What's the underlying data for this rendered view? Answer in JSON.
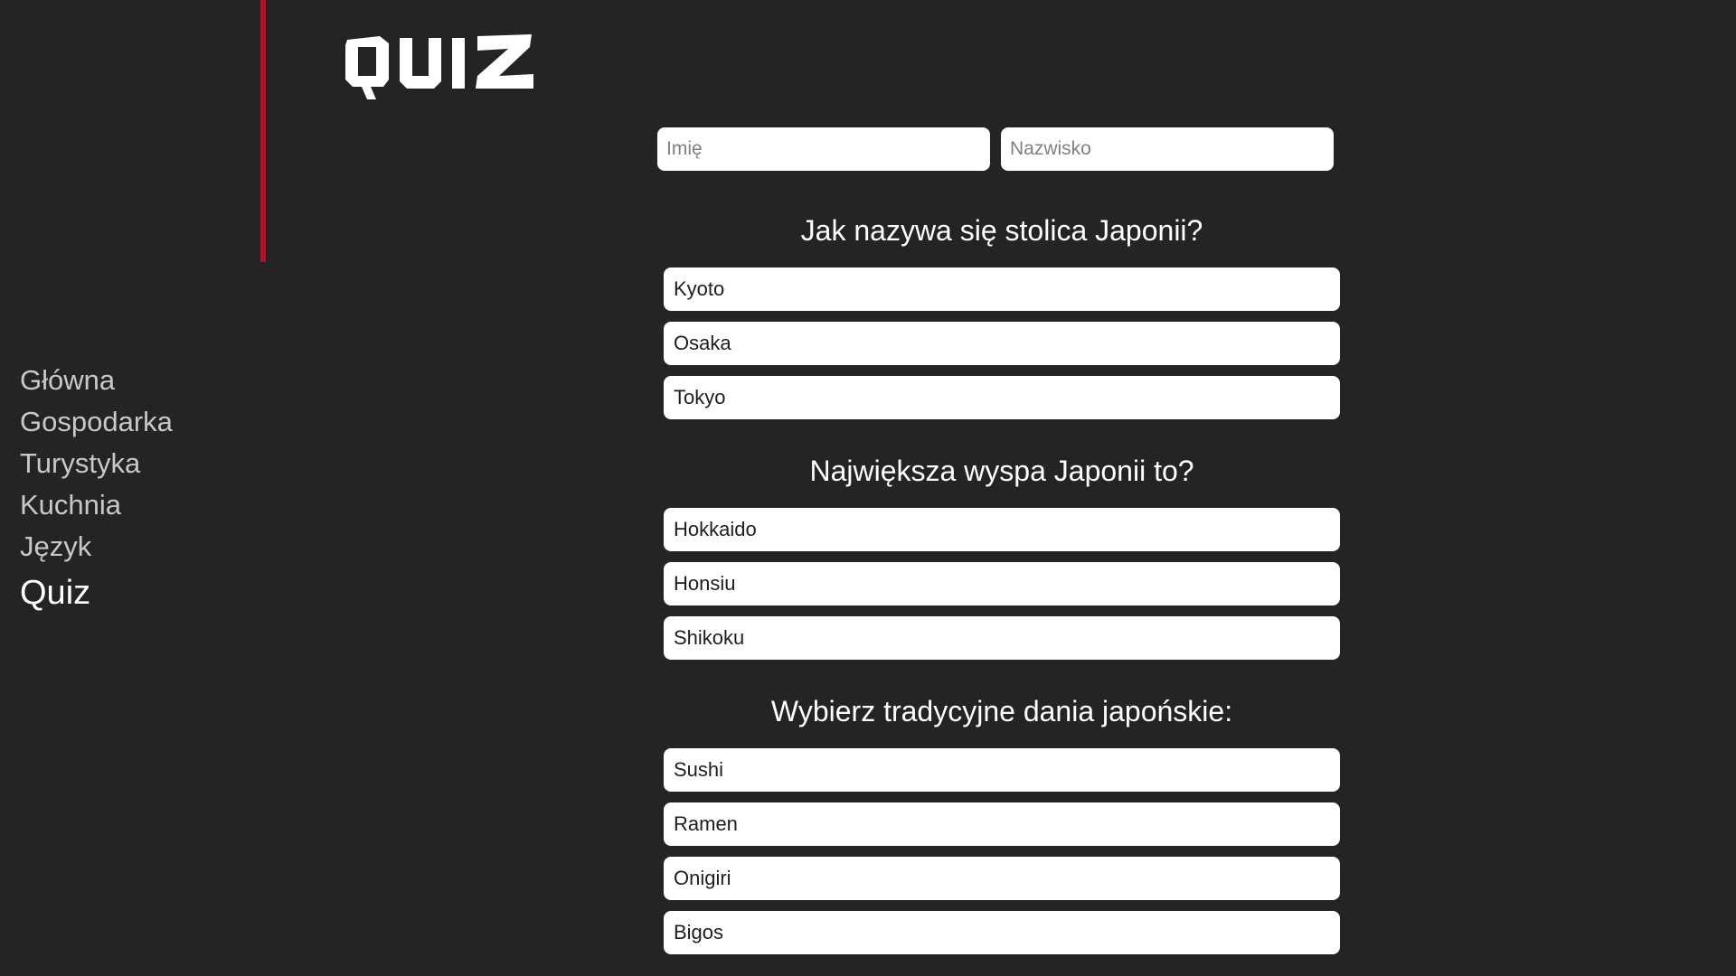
{
  "brand": {
    "logo_text": "QUIZ",
    "accent_color": "#b5122a",
    "background_color": "#242424"
  },
  "nav": {
    "items": [
      {
        "label": "Główna",
        "active": false
      },
      {
        "label": "Gospodarka",
        "active": false
      },
      {
        "label": "Turystyka",
        "active": false
      },
      {
        "label": "Kuchnia",
        "active": false
      },
      {
        "label": "Język",
        "active": false
      },
      {
        "label": "Quiz",
        "active": true
      }
    ]
  },
  "form": {
    "first_name_placeholder": "Imię",
    "last_name_placeholder": "Nazwisko",
    "first_name_value": "",
    "last_name_value": ""
  },
  "questions": [
    {
      "title": "Jak nazywa się stolica Japonii?",
      "options": [
        "Kyoto",
        "Osaka",
        "Tokyo"
      ]
    },
    {
      "title": "Największa wyspa Japonii to?",
      "options": [
        "Hokkaido",
        "Honsiu",
        "Shikoku"
      ]
    },
    {
      "title": "Wybierz tradycyjne dania japońskie:",
      "options": [
        "Sushi",
        "Ramen",
        "Onigiri",
        "Bigos"
      ]
    }
  ]
}
